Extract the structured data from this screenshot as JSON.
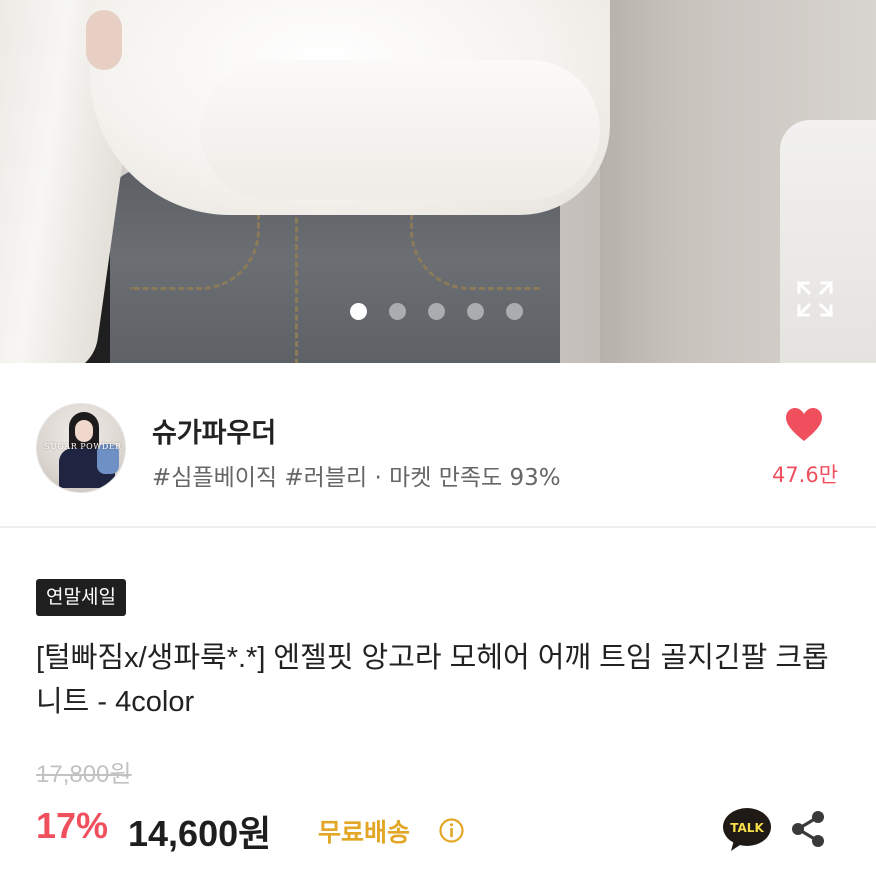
{
  "gallery": {
    "page_count": 5,
    "active_index": 0,
    "expand_icon": "expand-icon"
  },
  "seller": {
    "name": "슈가파우더",
    "tags": "#심플베이직 #러블리 · 마켓 만족도 93%",
    "avatar_brand_text": "SUGAR POWDER",
    "like_count": "47.6만",
    "like_icon": "heart-icon",
    "like_color": "#f0505e"
  },
  "product": {
    "badge": "연말세일",
    "title": "[털빠짐x/생파룩*.*] 엔젤핏 앙고라 모헤어 어깨 트임 골지긴팔 크롭니트 - 4color",
    "original_price": "17,800원",
    "discount_rate": "17%",
    "sale_price": "14,600원",
    "shipping": "무료배송",
    "shipping_color": "#e3a727",
    "discount_color": "#f0505e"
  },
  "actions": {
    "talk_label": "TALK",
    "talk_icon": "kakaotalk-icon",
    "share_icon": "share-icon"
  }
}
